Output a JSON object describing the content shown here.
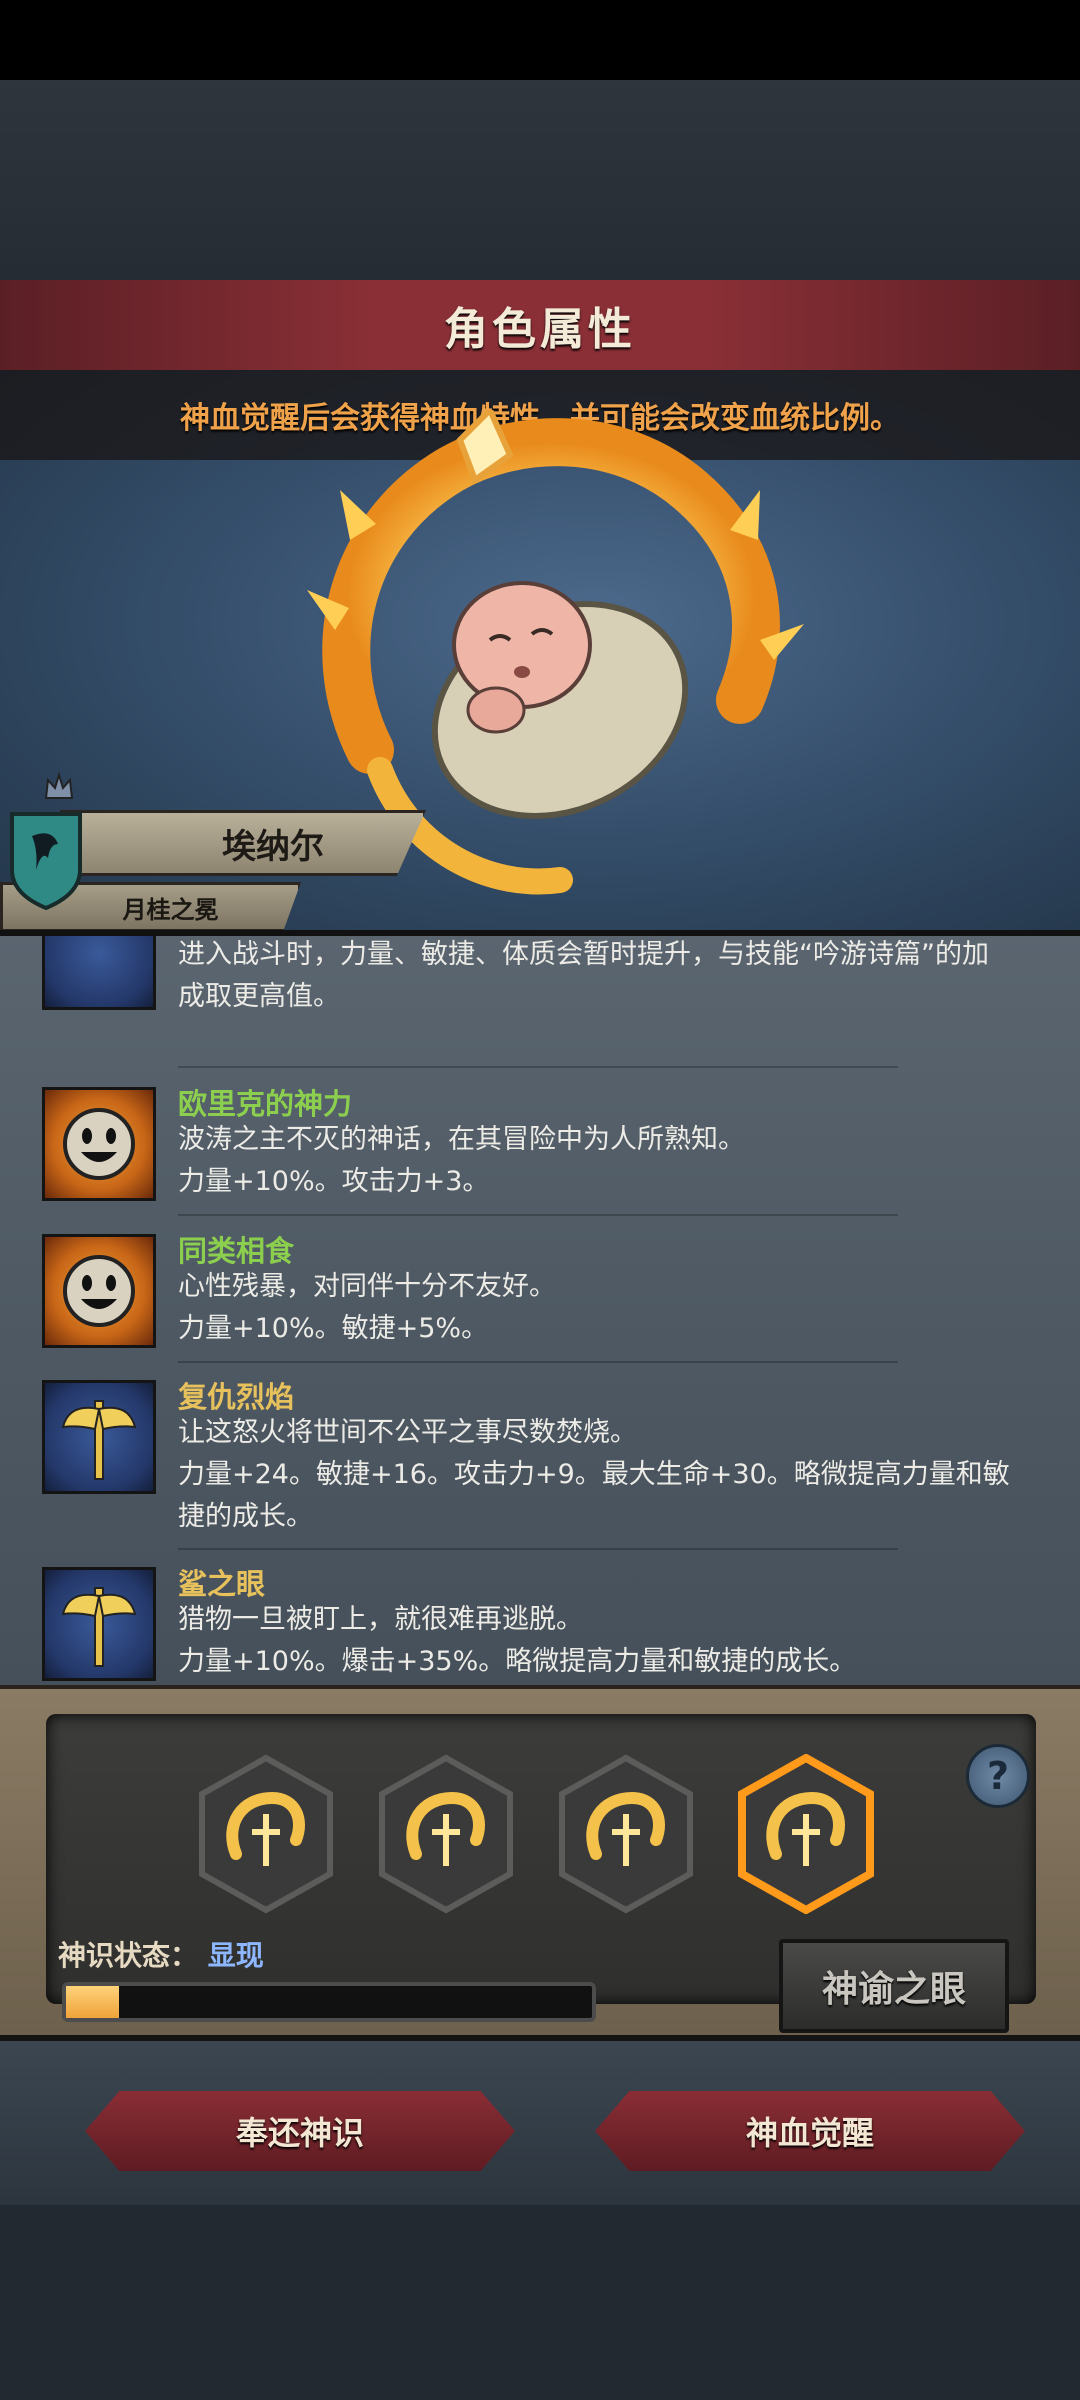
{
  "screen": {
    "title": "角色属性",
    "notice": "神血觉醒后会获得神血特性，并可能会改变血统比例。"
  },
  "character": {
    "name": "埃纳尔",
    "title": "月桂之冕",
    "clan_icon": "dragon-shield-icon",
    "rank_icon": "crown-icon"
  },
  "traits": [
    {
      "name": "",
      "icon": "axe-icon",
      "lines": [
        "进入战斗时，力量、敏捷、体质会暂时提升，与技能“吟游诗篇”的加",
        "成取更高值。"
      ]
    },
    {
      "name": "欧里克的神力",
      "name_color": "#8ccf4e",
      "icon": "smiling-sun-icon",
      "lines": [
        "波涛之主不灭的神话，在其冒险中为人所熟知。",
        "力量+10%。攻击力+3。"
      ]
    },
    {
      "name": "同类相食",
      "name_color": "#8ccf4e",
      "icon": "smiling-sun-icon",
      "lines": [
        "心性残暴，对同伴十分不友好。",
        "力量+10%。敏捷+5%。"
      ]
    },
    {
      "name": "复仇烈焰",
      "name_color": "#e7c15c",
      "icon": "axe-icon",
      "lines": [
        "让这怒火将世间不公平之事尽数焚烧。",
        "力量+24。敏捷+16。攻击力+9。最大生命+30。略微提高力量和敏",
        "捷的成长。"
      ]
    },
    {
      "name": "鲨之眼",
      "name_color": "#e7c15c",
      "icon": "axe-icon",
      "lines": [
        "猎物一旦被盯上，就很难再逃脱。",
        "力量+10%。爆击+35%。略微提高力量和敏捷的成长。"
      ]
    }
  ],
  "divine": {
    "slots": [
      "flame-crest-icon",
      "flame-crest-icon",
      "flame-crest-icon",
      "flame-crest-icon"
    ],
    "selected_slot": 4,
    "status_label": "神识状态：",
    "status_value": "显现",
    "progress": 0.1,
    "oracle_button": "神谕之眼",
    "help_icon": "question-icon",
    "help_text": "?"
  },
  "actions": {
    "return_label": "奉还神识",
    "awaken_label": "神血觉醒"
  },
  "colors": {
    "accent_orange": "#f0a24a",
    "trait_green": "#8ccf4e",
    "trait_gold": "#e7c15c",
    "status_blue": "#8db7ff",
    "banner_red": "#8a2f36"
  }
}
